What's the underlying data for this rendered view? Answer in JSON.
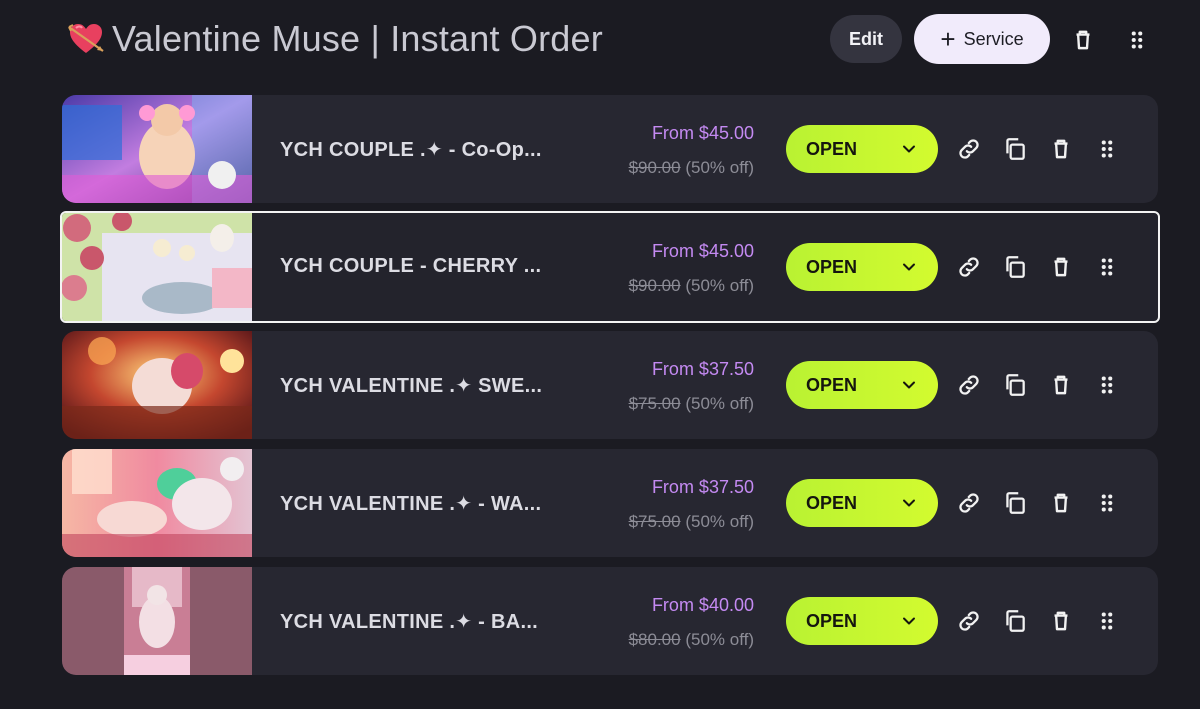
{
  "header": {
    "title_icon": "heart-with-arrow-icon",
    "title": "Valentine Muse | Instant Order",
    "edit_label": "Edit",
    "service_label": "Service"
  },
  "colors": {
    "background": "#1b1b22",
    "row": "#272731",
    "price_accent": "#c48af2",
    "status_green": "#c6f72f"
  },
  "services": [
    {
      "name": "YCH COUPLE .✦ - Co-Op...",
      "price_from": "From $45.00",
      "price_original": "$90.00",
      "discount": "(50% off)",
      "status": "OPEN",
      "thumb": "gaming-couple-neon-room"
    },
    {
      "name": "YCH COUPLE - CHERRY ...",
      "price_from": "From $45.00",
      "price_original": "$90.00",
      "discount": "(50% off)",
      "status": "OPEN",
      "thumb": "picnic-cherry-blossom"
    },
    {
      "name": "YCH VALENTINE .✦ SWE...",
      "price_from": "From $37.50",
      "price_original": "$75.00",
      "discount": "(50% off)",
      "status": "OPEN",
      "thumb": "valentine-sweets-red-gold"
    },
    {
      "name": "YCH VALENTINE .✦ - WA...",
      "price_from": "From $37.50",
      "price_original": "$75.00",
      "discount": "(50% off)",
      "status": "OPEN",
      "thumb": "valentine-pink-sofa"
    },
    {
      "name": "YCH VALENTINE .✦ - BA...",
      "price_from": "From $40.00",
      "price_original": "$80.00",
      "discount": "(50% off)",
      "status": "OPEN",
      "thumb": "valentine-bath-portrait"
    }
  ]
}
